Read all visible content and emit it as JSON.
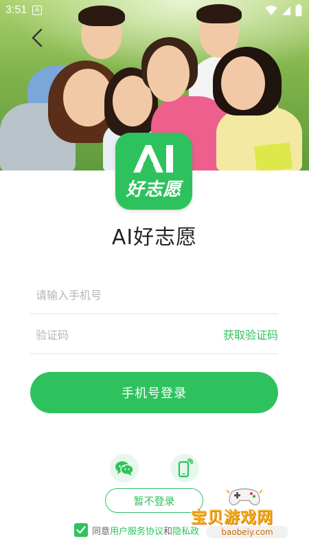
{
  "status_bar": {
    "time": "3:51",
    "notification_glyph": "A"
  },
  "app": {
    "logo_subtitle": "好志愿",
    "name": "AI好志愿"
  },
  "form": {
    "phone_placeholder": "请输入手机号",
    "phone_value": "",
    "code_placeholder": "验证码",
    "code_value": "",
    "get_code_label": "获取验证码",
    "login_label": "手机号登录"
  },
  "social": {
    "icons": [
      "wechat-icon",
      "phone-signal-icon"
    ]
  },
  "skip_label": "暂不登录",
  "agreement": {
    "checked": true,
    "prefix": "同意",
    "terms_link": "用户服务协议",
    "conjunction": "和",
    "privacy_link": "隐私政"
  },
  "watermark": {
    "name": "宝贝游戏网",
    "url": "baobeiy.com"
  },
  "colors": {
    "brand_green": "#2ec25e",
    "link_green": "#2ec25e",
    "placeholder": "#b5b5b5"
  }
}
